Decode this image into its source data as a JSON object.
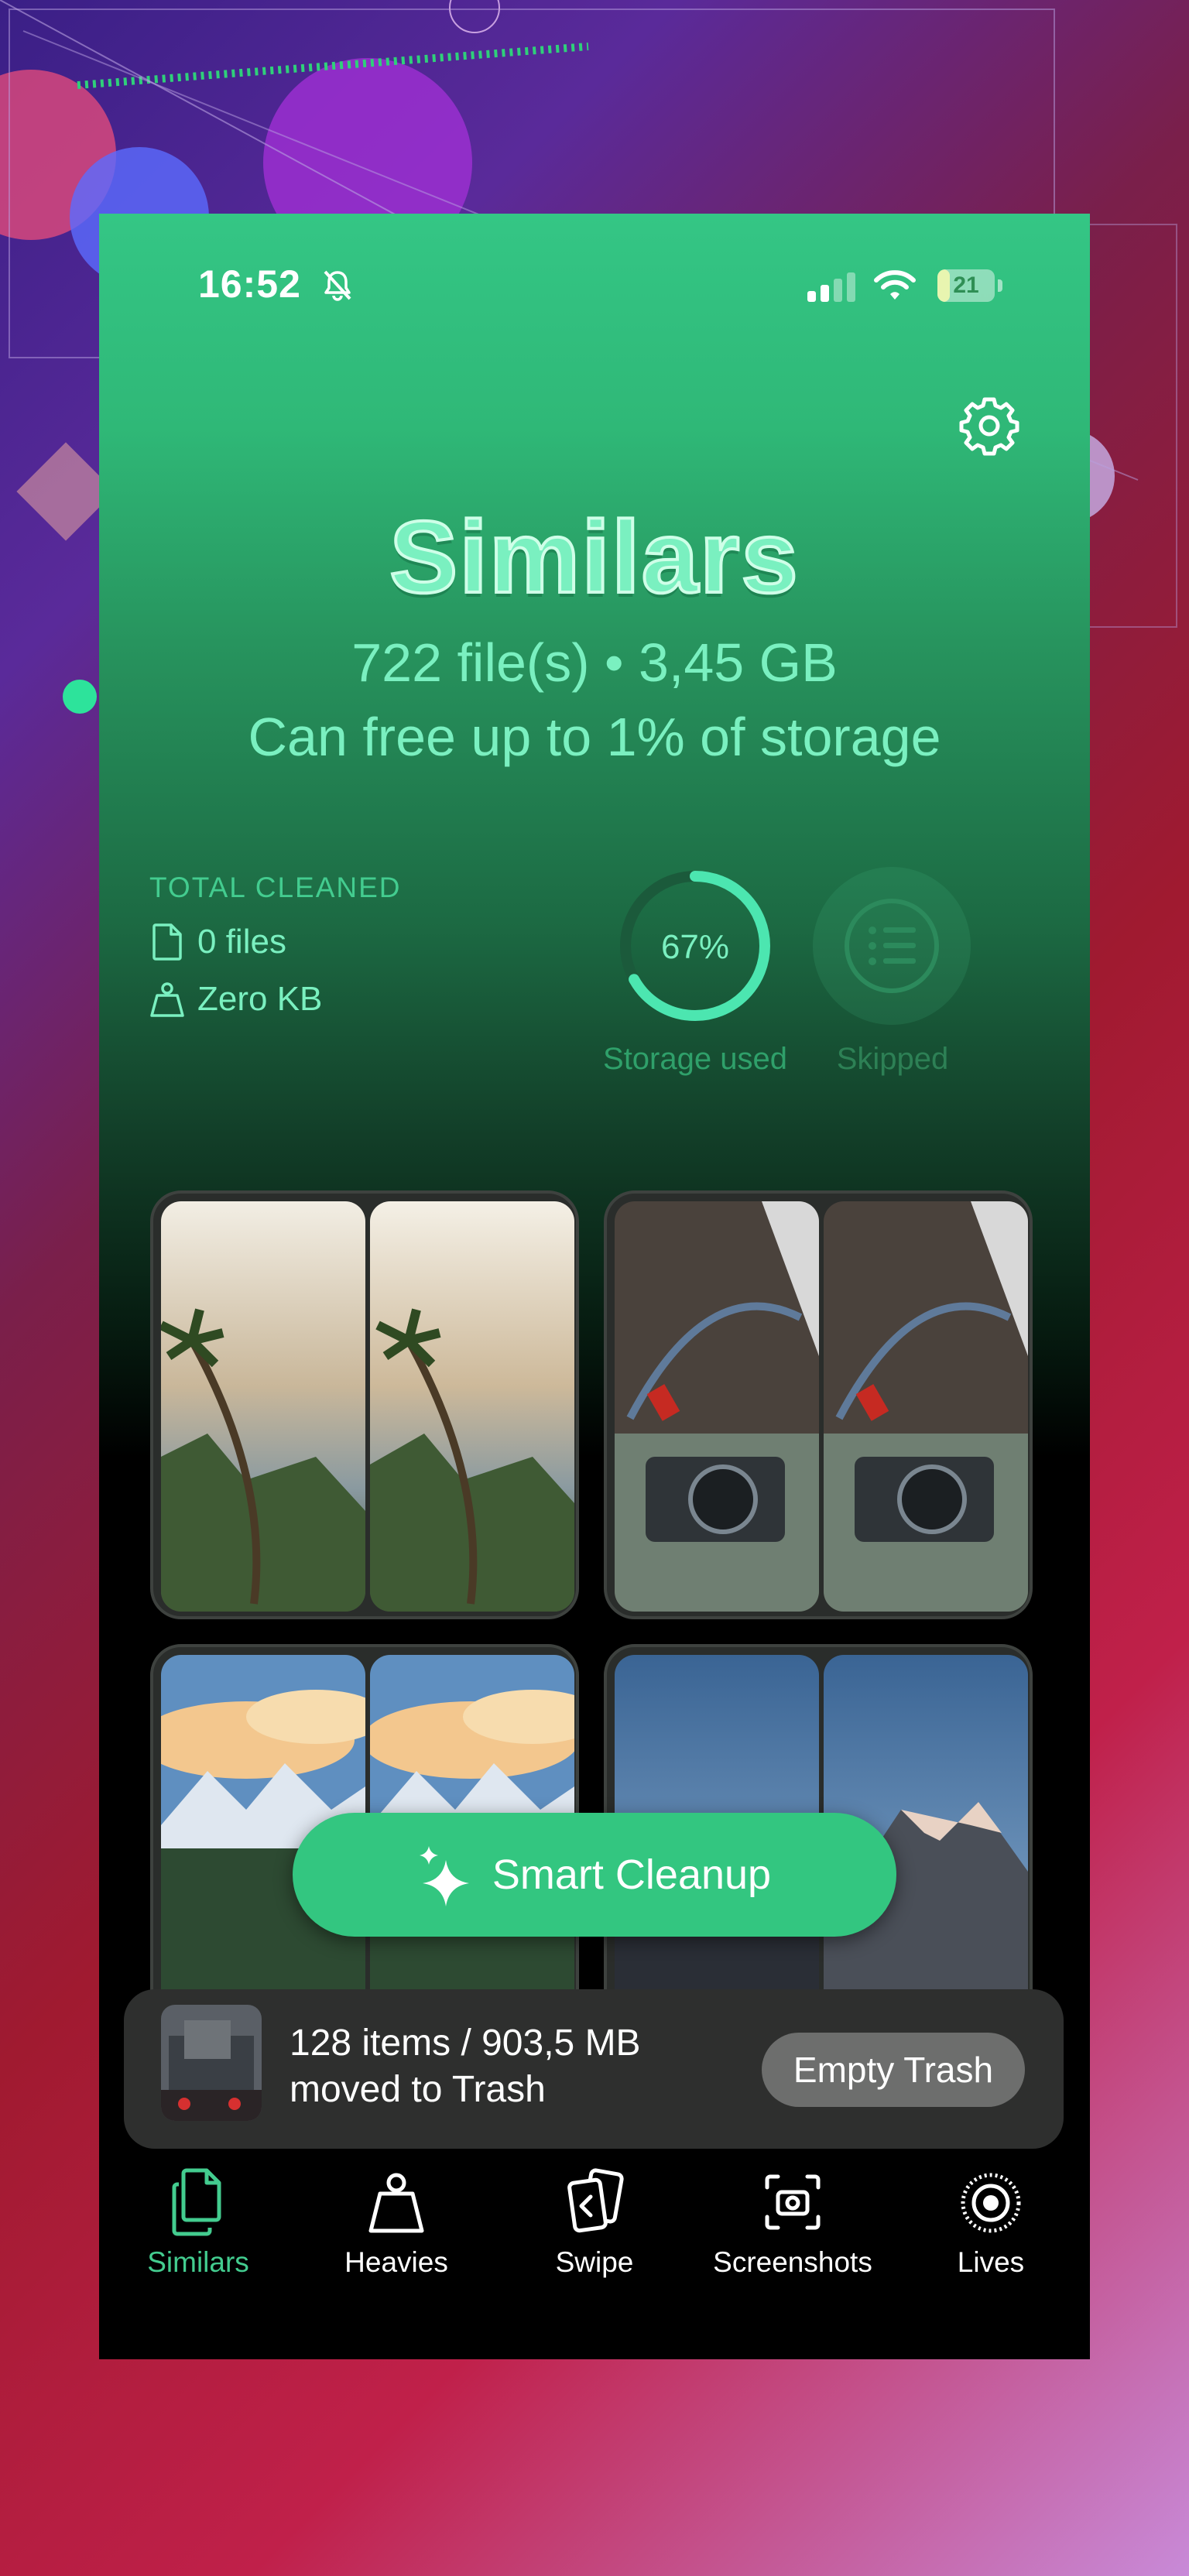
{
  "status_bar": {
    "time": "16:52",
    "battery": "21",
    "battery_level": 0.21,
    "icons": [
      "bell-slash-icon",
      "cellular-signal-icon",
      "wifi-icon",
      "battery-icon"
    ]
  },
  "header": {
    "title": "Similars",
    "summary": "722 file(s) • 3,45 GB",
    "storage_note": "Can free up to 1% of storage",
    "settings_icon": "gear-icon"
  },
  "total_cleaned": {
    "label": "TOTAL CLEANED",
    "files": "0 files",
    "size": "Zero KB"
  },
  "storage": {
    "percent_label": "67%",
    "percent": 67,
    "label": "Storage used"
  },
  "skipped": {
    "label": "Skipped",
    "icon": "list-icon"
  },
  "groups": [
    {
      "name": "palm-beach-pair"
    },
    {
      "name": "camera-strap-pair"
    },
    {
      "name": "mountain-clouds-pair"
    },
    {
      "name": "mountain-sky-pair"
    }
  ],
  "smart_cleanup": {
    "label": "Smart Cleanup",
    "icon": "sparkles-icon"
  },
  "trash": {
    "line1": "128 items / 903,5 MB",
    "line2": "moved to Trash",
    "button": "Empty Trash"
  },
  "tabs": [
    {
      "label": "Similars",
      "icon": "documents-icon",
      "active": true
    },
    {
      "label": "Heavies",
      "icon": "weight-icon",
      "active": false
    },
    {
      "label": "Swipe",
      "icon": "swipe-cards-icon",
      "active": false
    },
    {
      "label": "Screenshots",
      "icon": "screenshot-camera-icon",
      "active": false
    },
    {
      "label": "Lives",
      "icon": "live-photo-icon",
      "active": false
    }
  ],
  "colors": {
    "accent": "#33c680",
    "accent_light": "#7af0c0",
    "background_top": "#34c685",
    "background_bottom": "#000000"
  }
}
